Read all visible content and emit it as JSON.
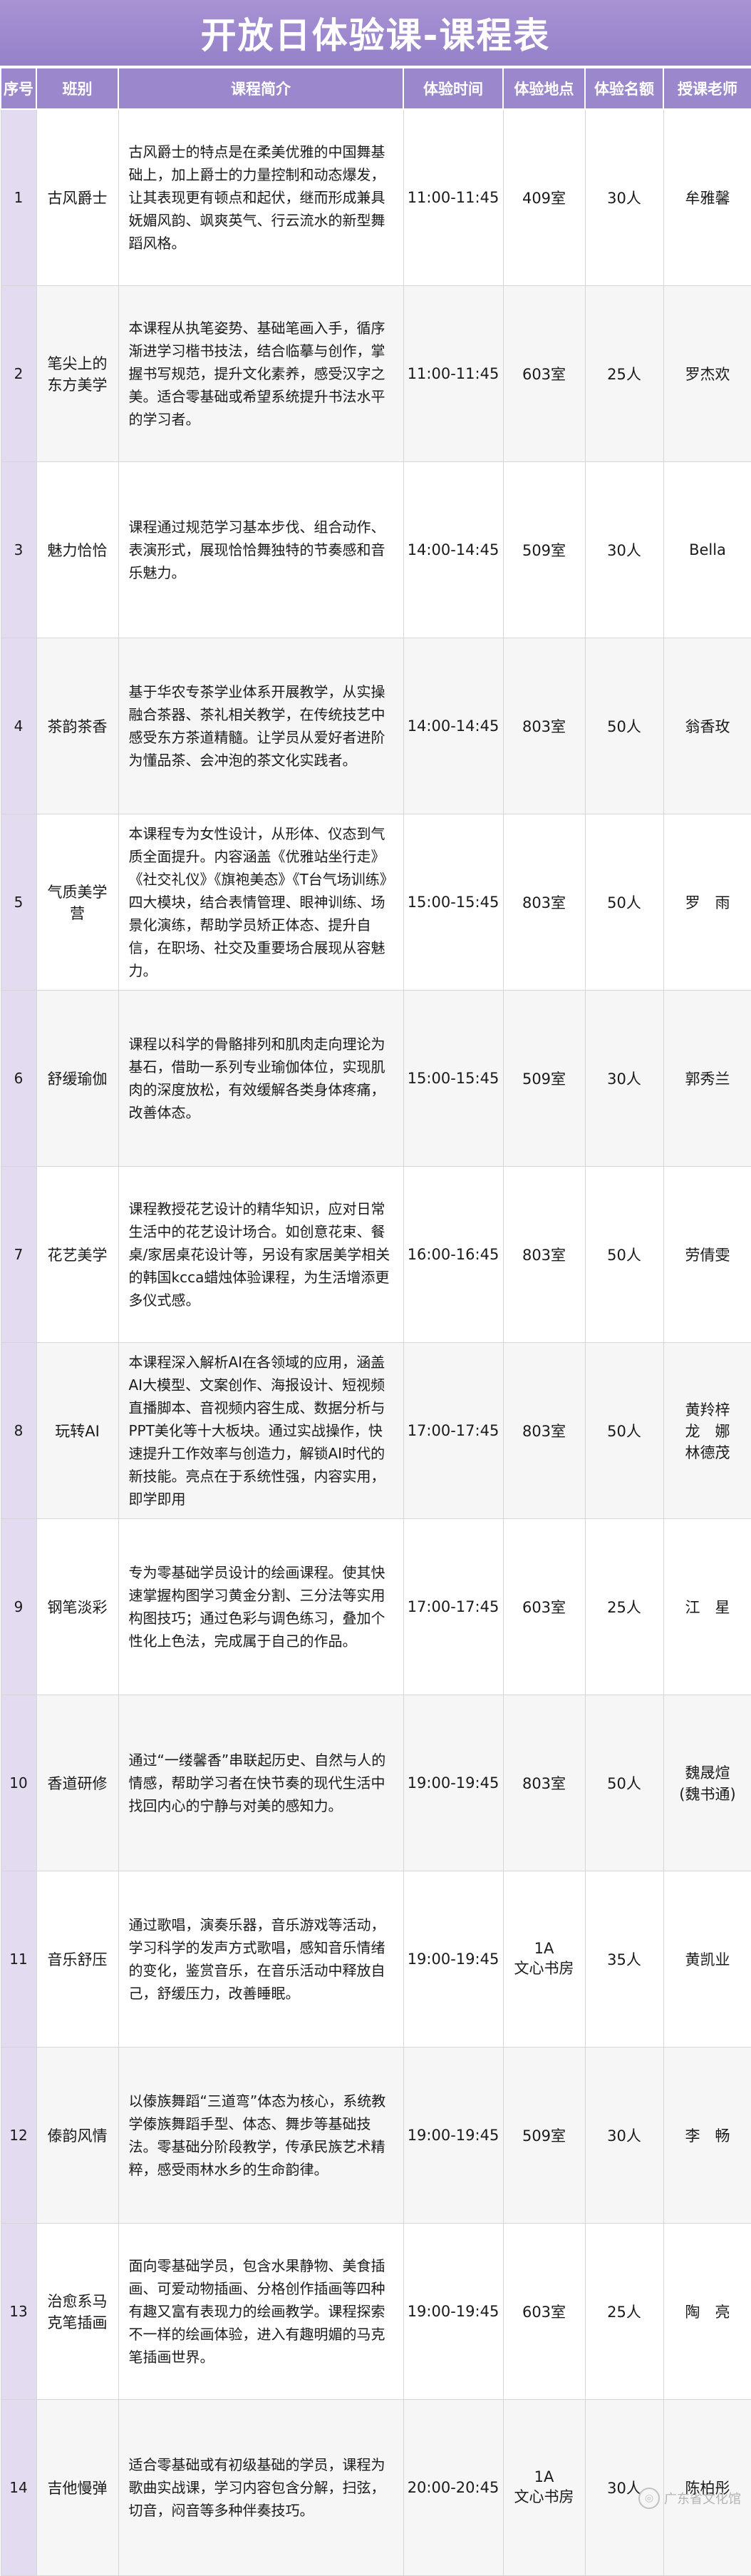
{
  "title": "开放日体验课-课程表",
  "headers": [
    "序号",
    "班别",
    "课程简介",
    "体验时间",
    "体验地点",
    "体验名额",
    "授课老师"
  ],
  "rows": [
    {
      "no": "1",
      "name": "古风爵士",
      "intro": "古风爵士的特点是在柔美优雅的中国舞基础上，加上爵士的力量控制和动态爆发，让其表现更有顿点和起伏，继而形成兼具妩媚风韵、飒爽英气、行云流水的新型舞蹈风格。",
      "time": "11:00-11:45",
      "place": "409室",
      "quota": "30人",
      "teacher": "牟雅馨"
    },
    {
      "no": "2",
      "name": "笔尖上的东方美学",
      "intro": "本课程从执笔姿势、基础笔画入手，循序渐进学习楷书技法，结合临摹与创作，掌握书写规范，提升文化素养，感受汉字之美。适合零基础或希望系统提升书法水平的学习者。",
      "time": "11:00-11:45",
      "place": "603室",
      "quota": "25人",
      "teacher": "罗杰欢"
    },
    {
      "no": "3",
      "name": "魅力恰恰",
      "intro": "课程通过规范学习基本步伐、组合动作、表演形式，展现恰恰舞独特的节奏感和音乐魅力。",
      "time": "14:00-14:45",
      "place": "509室",
      "quota": "30人",
      "teacher": "Bella"
    },
    {
      "no": "4",
      "name": "茶韵茶香",
      "intro": "基于华农专茶学业体系开展教学，从实操融合茶器、茶礼相关教学，在传统技艺中感受东方茶道精髓。让学员从爱好者进阶为懂品茶、会冲泡的茶文化实践者。",
      "time": "14:00-14:45",
      "place": "803室",
      "quota": "50人",
      "teacher": "翁香玫"
    },
    {
      "no": "5",
      "name": "气质美学营",
      "intro": "本课程专为女性设计，从形体、仪态到气质全面提升。内容涵盖《优雅站坐行走》《社交礼仪》《旗袍美态》《T台气场训练》四大模块，结合表情管理、眼神训练、场景化演练，帮助学员矫正体态、提升自信，在职场、社交及重要场合展现从容魅力。",
      "time": "15:00-15:45",
      "place": "803室",
      "quota": "50人",
      "teacher": "罗　雨"
    },
    {
      "no": "6",
      "name": "舒缓瑜伽",
      "intro": "课程以科学的骨骼排列和肌肉走向理论为基石，借助一系列专业瑜伽体位，实现肌肉的深度放松，有效缓解各类身体疼痛，改善体态。",
      "time": "15:00-15:45",
      "place": "509室",
      "quota": "30人",
      "teacher": "郭秀兰"
    },
    {
      "no": "7",
      "name": "花艺美学",
      "intro": "课程教授花艺设计的精华知识，应对日常生活中的花艺设计场合。如创意花束、餐桌/家居桌花设计等，另设有家居美学相关的韩国kcca蜡烛体验课程，为生活增添更多仪式感。",
      "time": "16:00-16:45",
      "place": "803室",
      "quota": "50人",
      "teacher": "劳倩雯"
    },
    {
      "no": "8",
      "name": "玩转AI",
      "intro": "本课程深入解析AI在各领域的应用，涵盖AI大模型、文案创作、海报设计、短视频直播脚本、音视频内容生成、数据分析与PPT美化等十大板块。通过实战操作，快速提升工作效率与创造力，解锁AI时代的新技能。亮点在于系统性强，内容实用，即学即用",
      "time": "17:00-17:45",
      "place": "803室",
      "quota": "50人",
      "teacher": "黄羚梓\n龙　娜\n林德茂"
    },
    {
      "no": "9",
      "name": "钢笔淡彩",
      "intro": "专为零基础学员设计的绘画课程。使其快速掌握构图学习黄金分割、三分法等实用构图技巧；通过色彩与调色练习，叠加个性化上色法，完成属于自己的作品。",
      "time": "17:00-17:45",
      "place": "603室",
      "quota": "25人",
      "teacher": "江　星"
    },
    {
      "no": "10",
      "name": "香道研修",
      "intro": "通过“一缕馨香”串联起历史、自然与人的情感，帮助学习者在快节奏的现代生活中找回内心的宁静与对美的感知力。",
      "time": "19:00-19:45",
      "place": "803室",
      "quota": "50人",
      "teacher": "魏晟煊\n(魏书通)"
    },
    {
      "no": "11",
      "name": "音乐舒压",
      "intro": "通过歌唱，演奏乐器，音乐游戏等活动，学习科学的发声方式歌唱，感知音乐情绪的变化，鉴赏音乐，在音乐活动中释放自己，舒缓压力，改善睡眠。",
      "time": "19:00-19:45",
      "place": "1A\n文心书房",
      "quota": "35人",
      "teacher": "黄凯业"
    },
    {
      "no": "12",
      "name": "傣韵风情",
      "intro": "以傣族舞蹈“三道弯”体态为核心，系统教学傣族舞蹈手型、体态、舞步等基础技法。零基础分阶段教学，传承民族艺术精粹，感受雨林水乡的生命韵律。",
      "time": "19:00-19:45",
      "place": "509室",
      "quota": "30人",
      "teacher": "李　畅"
    },
    {
      "no": "13",
      "name": "治愈系马克笔插画",
      "intro": "面向零基础学员，包含水果静物、美食插画、可爱动物插画、分格创作插画等四种有趣又富有表现力的绘画教学。课程探索不一样的绘画体验，进入有趣明媚的马克笔插画世界。",
      "time": "19:00-19:45",
      "place": "603室",
      "quota": "25人",
      "teacher": "陶　亮"
    },
    {
      "no": "14",
      "name": "吉他慢弹",
      "intro": "适合零基础或有初级基础的学员，课程为歌曲实战课，学习内容包含分解，扫弦，切音，闷音等多种伴奏技巧。",
      "time": "20:00-20:45",
      "place": "1A\n文心书房",
      "quota": "30人",
      "teacher": "陈柏彤"
    }
  ],
  "watermark": {
    "icon": "gd-culture-logo-icon",
    "text": "广东省文化馆"
  }
}
